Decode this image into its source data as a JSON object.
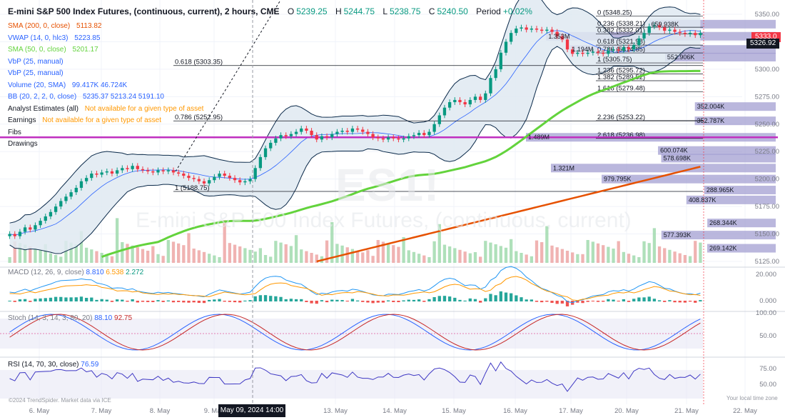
{
  "header": {
    "title": "E-mini S&P 500 Index Futures, (continuous, current), 2 hours, CME",
    "open_label": "O",
    "open": "5239.25",
    "high_label": "H",
    "high": "5244.75",
    "low_label": "L",
    "low": "5238.75",
    "close_label": "C",
    "close": "5240.50",
    "period_label": "Period",
    "period": "+0.02%"
  },
  "indicators": [
    {
      "label": "SMA (200, 0, close)",
      "value": "5113.82",
      "color": "#e65100"
    },
    {
      "label": "VWAP (14, 0, hlc3)",
      "value": "5223.85",
      "color": "#2962ff"
    },
    {
      "label": "SMA (50, 0, close)",
      "value": "5201.17",
      "color": "#63d33c"
    },
    {
      "label": "VbP (25, manual)",
      "value": "",
      "color": "#2962ff"
    },
    {
      "label": "VbP (25, manual)",
      "value": "",
      "color": "#2962ff"
    },
    {
      "label": "Volume (20, SMA)",
      "value": "99.417K  46.724K",
      "color": "#2962ff"
    },
    {
      "label": "BB (20, 2, 2, 0, close)",
      "value": "5235.37  5213.24  5191.10",
      "color": "#2962ff"
    },
    {
      "label": "Analyst Estimates (all)",
      "value": "Not available for a given type of asset",
      "color": "#ff9800"
    },
    {
      "label": "Earnings",
      "value": "Not available for a given type of asset",
      "color": "#ff9800"
    },
    {
      "label": "Fibs",
      "value": "",
      "color": "#131722"
    },
    {
      "label": "Drawings",
      "value": "",
      "color": "#131722"
    }
  ],
  "watermark": {
    "symbol": "ES1!",
    "name": "E-mini S&P 500 Index Futures, (continuous, current)"
  },
  "colors": {
    "up": "#089981",
    "down": "#f23645",
    "sma200": "#e65100",
    "sma50": "#63d33c",
    "bb": "#2962ff",
    "fib_mid": "#c030c0",
    "vbp": "#9c98cf"
  },
  "panes": {
    "macd": {
      "label": "MACD (12, 26, 9, close)",
      "v1": "8.810",
      "v2": "6.538",
      "v3": "2.272"
    },
    "stoch": {
      "label": "Stoch (14, 3, 14, 3, 80, 20)",
      "v1": "88.10",
      "v2": "92.75"
    },
    "rsi": {
      "label": "RSI (14, 70, 30, close)",
      "v1": "76.59"
    }
  },
  "footer": {
    "copyright": "©2024 TrendSpider. Market data via ICE",
    "timezone": "Your local time zone",
    "cursor_date": "May 09, 2024 14:00"
  },
  "price_tags": {
    "last": "5333.0",
    "current": "5326.92"
  },
  "chart_data": {
    "type": "candlestick",
    "title": "E-mini S&P 500 Index Futures, (continuous, current), 2 hours, CME",
    "ylim": [
      5125,
      5350
    ],
    "y_ticks": [
      "5350.00",
      "5325.00",
      "5300.00",
      "5275.00",
      "5250.00",
      "5225.00",
      "5200.00",
      "5175.00",
      "5150.00",
      "5125.00"
    ],
    "x_ticks": [
      "6. May",
      "7. May",
      "8. May",
      "9. May",
      "13. May",
      "14. May",
      "15. May",
      "16. May",
      "17. May",
      "20. May",
      "21. May",
      "22. May"
    ],
    "fib_levels": [
      {
        "label": "0 (5348.25)",
        "price": 5348.25
      },
      {
        "label": "0.236 (5338.21)",
        "price": 5338.21
      },
      {
        "label": "0.382 (5332.01)",
        "price": 5332.01
      },
      {
        "label": "0.618 (5321.98)",
        "price": 5321.98
      },
      {
        "label": "0.786 (5314.85)",
        "price": 5314.85
      },
      {
        "label": "1 (5305.75)",
        "price": 5305.75
      },
      {
        "label": "1.236 (5295.72)",
        "price": 5295.72
      },
      {
        "label": "1.382 (5289.52)",
        "price": 5289.52
      },
      {
        "label": "1.618 (5279.48)",
        "price": 5279.48
      },
      {
        "label": "2.236 (5253.22)",
        "price": 5253.22
      },
      {
        "label": "2.618 (5236.98)",
        "price": 5236.98
      },
      {
        "label": "0.618 (5303.35)",
        "price": 5303.35
      },
      {
        "label": "0.786 (5252.95)",
        "price": 5252.95
      },
      {
        "label": "1 (5188.75)",
        "price": 5188.75
      }
    ],
    "fib_mid_price": 5238.0,
    "volume_profile": [
      {
        "label": "659.938K",
        "price": 5341,
        "value": 659.938
      },
      {
        "label": "1.353M",
        "price": 5330,
        "value": 1353
      },
      {
        "label": "1.194M",
        "price": 5318,
        "value": 1194
      },
      {
        "label": "552.906K",
        "price": 5311,
        "value": 552.906
      },
      {
        "label": "352.004K",
        "price": 5266,
        "value": 352.004
      },
      {
        "label": "352.787K",
        "price": 5253,
        "value": 352.787
      },
      {
        "label": "1.489M",
        "price": 5238,
        "value": 1489
      },
      {
        "label": "600.074K",
        "price": 5226,
        "value": 600.074
      },
      {
        "label": "578.698K",
        "price": 5219,
        "value": 578.698
      },
      {
        "label": "1.321M",
        "price": 5210,
        "value": 1321
      },
      {
        "label": "979.795K",
        "price": 5200,
        "value": 979.795
      },
      {
        "label": "288.965K",
        "price": 5190,
        "value": 288.965
      },
      {
        "label": "408.837K",
        "price": 5181,
        "value": 408.837
      },
      {
        "label": "268.344K",
        "price": 5160,
        "value": 268.344
      },
      {
        "label": "577.393K",
        "price": 5149,
        "value": 577.393
      },
      {
        "label": "269.142K",
        "price": 5137,
        "value": 269.142
      }
    ],
    "macd_ticks": [
      "20.000",
      "0.000"
    ],
    "stoch_ticks": [
      "100.00",
      "50.00"
    ],
    "rsi_ticks": [
      "75.00",
      "50.00"
    ],
    "closes": [
      5150,
      5148,
      5152,
      5156,
      5154,
      5158,
      5162,
      5166,
      5170,
      5175,
      5180,
      5184,
      5188,
      5192,
      5198,
      5201,
      5205,
      5204,
      5206,
      5207,
      5205,
      5208,
      5210,
      5209,
      5212,
      5209,
      5208,
      5207,
      5206,
      5208,
      5207,
      5208,
      5206,
      5205,
      5203,
      5201,
      5200,
      5198,
      5196,
      5199,
      5202,
      5205,
      5203,
      5201,
      5199,
      5197,
      5198,
      5200,
      5210,
      5220,
      5228,
      5233,
      5237,
      5240,
      5239,
      5241,
      5243,
      5246,
      5244,
      5240,
      5236,
      5239,
      5238,
      5241,
      5243,
      5244,
      5243,
      5246,
      5245,
      5243,
      5241,
      5238,
      5237,
      5236,
      5238,
      5237,
      5236,
      5237,
      5239,
      5240,
      5242,
      5240,
      5243,
      5250,
      5258,
      5265,
      5270,
      5272,
      5270,
      5268,
      5272,
      5275,
      5272,
      5278,
      5292,
      5300,
      5315,
      5325,
      5333,
      5337,
      5338,
      5336,
      5337,
      5336,
      5335,
      5336,
      5334,
      5330,
      5327,
      5318,
      5314,
      5315,
      5314,
      5315,
      5316,
      5315,
      5314,
      5317,
      5318,
      5317,
      5320,
      5318,
      5322,
      5328,
      5333,
      5339,
      5340,
      5338,
      5335,
      5336,
      5334,
      5333,
      5332,
      5333,
      5331,
      5333
    ]
  }
}
